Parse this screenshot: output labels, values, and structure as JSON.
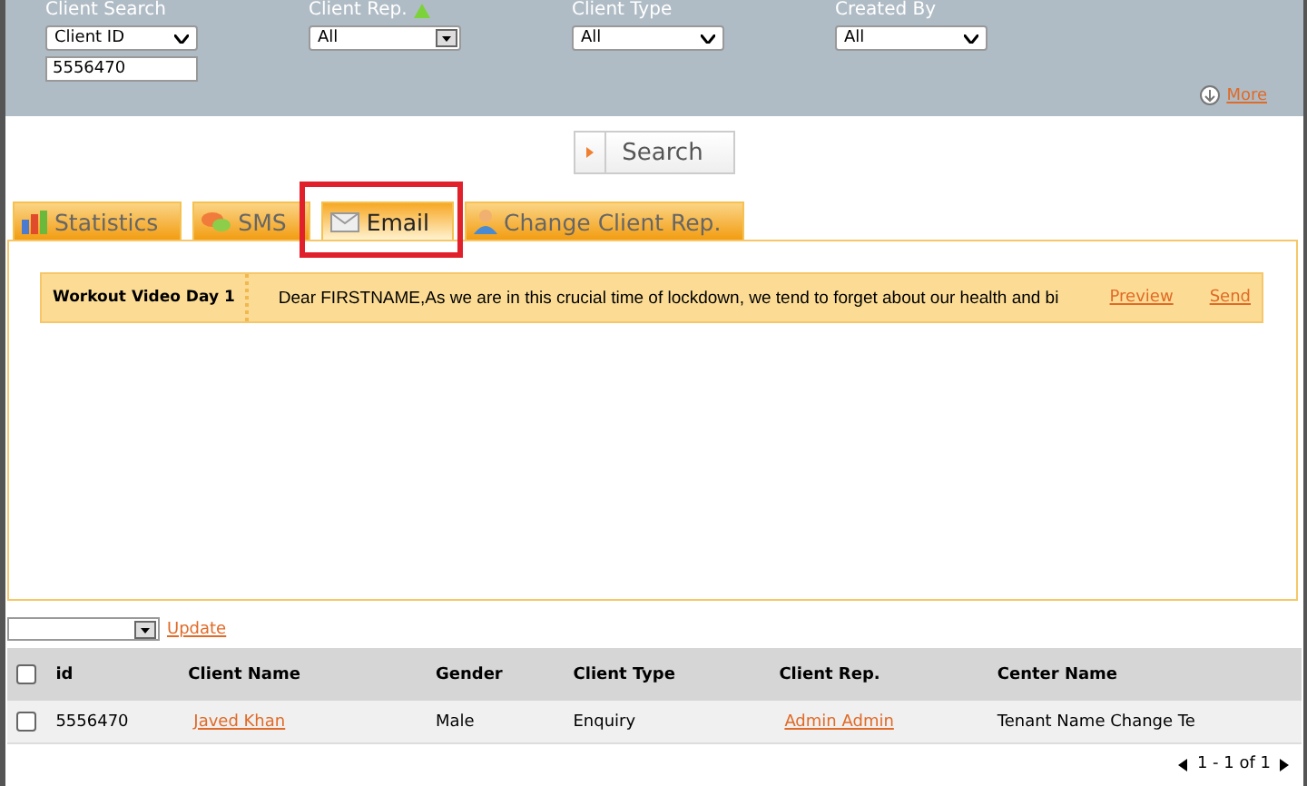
{
  "filters": [
    {
      "label": "Client Search",
      "sort_marker": false,
      "select": "Client ID",
      "kind": "native",
      "input": "5556470"
    },
    {
      "label": "Client Rep.",
      "sort_marker": true,
      "select": "All",
      "kind": "combo"
    },
    {
      "label": "Client Type",
      "sort_marker": false,
      "select": "All",
      "kind": "native"
    },
    {
      "label": "Created By",
      "sort_marker": false,
      "select": "All",
      "kind": "native"
    }
  ],
  "more_link": "More",
  "search_button": "Search",
  "tabs": [
    {
      "label": "Statistics",
      "selected": false,
      "highlighted": false
    },
    {
      "label": "SMS",
      "selected": false,
      "highlighted": false
    },
    {
      "label": "Email",
      "selected": true,
      "highlighted": true
    },
    {
      "label": "Change Client Rep.",
      "selected": false,
      "highlighted": false
    }
  ],
  "templates": [
    {
      "name": "Workout Video Day 1",
      "body": "Dear FIRSTNAME,As we are in this crucial time of lockdown, we tend to forget about our health and bi",
      "actions": [
        "Preview",
        "Send"
      ]
    }
  ],
  "bulk": {
    "update_link": "Update"
  },
  "table": {
    "select_all_checked": false,
    "columns": [
      "id",
      "Client Name",
      "Gender",
      "Client Type",
      "Client Rep.",
      "Center Name"
    ],
    "rows": [
      {
        "checked": false,
        "cells": [
          {
            "text": "5556470",
            "link": false
          },
          {
            "text": "Javed Khan",
            "link": true
          },
          {
            "text": "Male",
            "link": false
          },
          {
            "text": "Enquiry",
            "link": false
          },
          {
            "text": "Admin Admin",
            "link": true
          },
          {
            "text": "Tenant Name Change Te",
            "link": false
          }
        ]
      }
    ]
  },
  "pagination": "1 - 1 of 1"
}
